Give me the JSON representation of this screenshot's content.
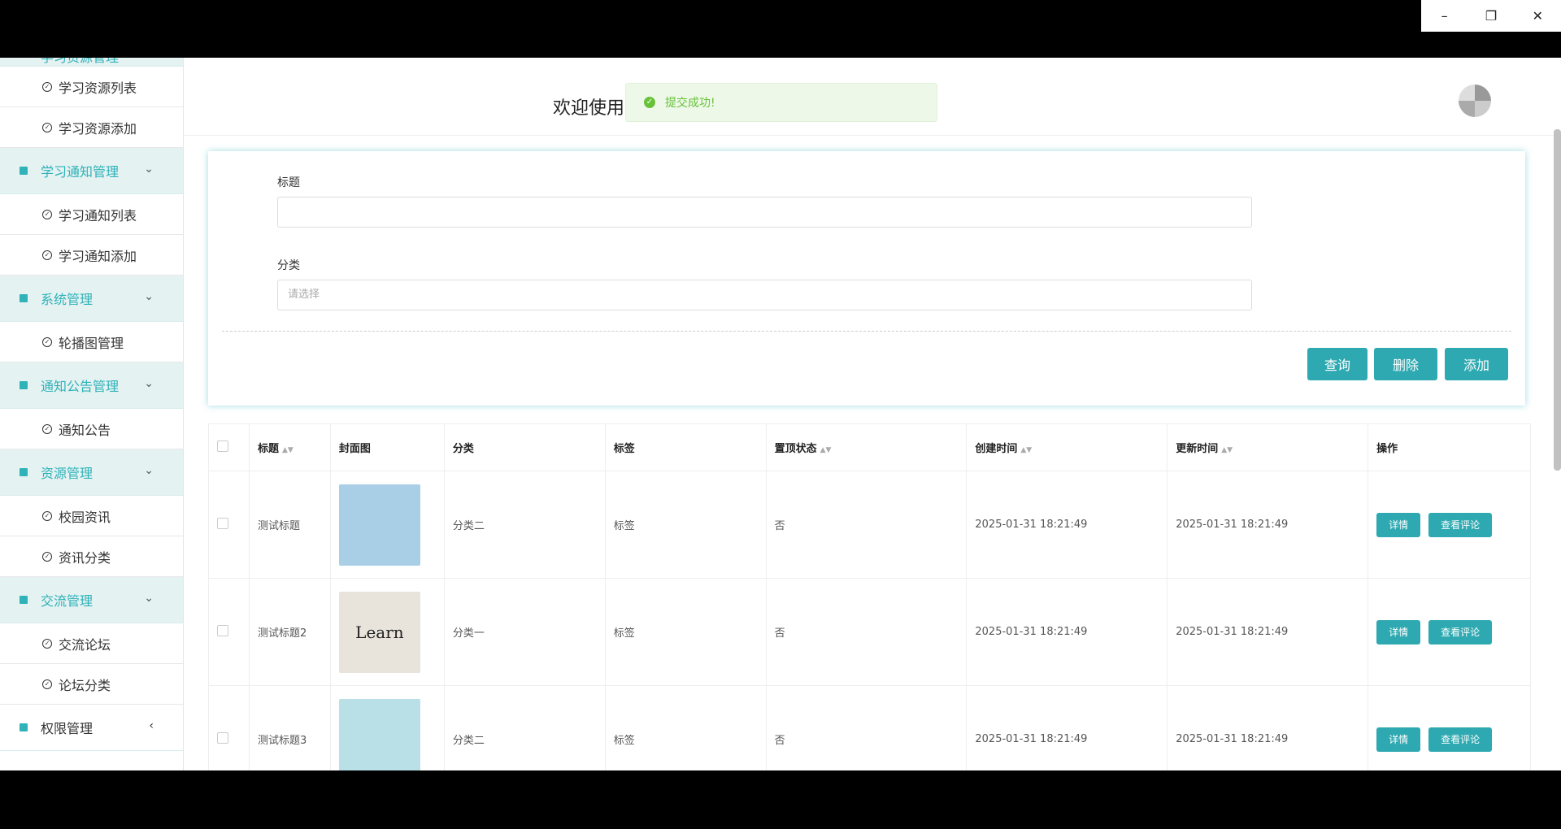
{
  "sidebar": {
    "partial_group": {
      "label": "学习资源管理"
    },
    "groups": [
      {
        "label": "学习资源列表",
        "type": "item"
      },
      {
        "label": "学习资源添加",
        "type": "item"
      }
    ],
    "notice_group": {
      "label": "学习通知管理",
      "items": [
        "学习通知列表",
        "学习通知添加"
      ]
    },
    "system_group": {
      "label": "系统管理",
      "items": [
        "轮播图管理"
      ]
    },
    "announce_group": {
      "label": "通知公告管理",
      "items": [
        "通知公告"
      ]
    },
    "resource_group": {
      "label": "资源管理",
      "items": [
        "校园资讯",
        "资讯分类"
      ]
    },
    "forum_group": {
      "label": "交流管理",
      "items": [
        "交流论坛",
        "论坛分类"
      ]
    },
    "perm_group": {
      "label": "权限管理"
    }
  },
  "header": {
    "welcome": "欢迎使用",
    "toast": "提交成功!"
  },
  "filter": {
    "title_label": "标题",
    "title_value": "",
    "category_label": "分类",
    "category_placeholder": "请选择",
    "query_btn": "查询",
    "delete_btn": "删除",
    "add_btn": "添加"
  },
  "table": {
    "headers": [
      "标题",
      "封面图",
      "分类",
      "标签",
      "置顶状态",
      "创建时间",
      "更新时间",
      "操作"
    ],
    "rows": [
      {
        "title": "测试标题",
        "category": "分类二",
        "tag": "标签",
        "top": "否",
        "created": "2025-01-31 18:21:49",
        "updated": "2025-01-31 18:21:49"
      },
      {
        "title": "测试标题2",
        "category": "分类一",
        "tag": "标签",
        "top": "否",
        "created": "2025-01-31 18:21:49",
        "updated": "2025-01-31 18:21:49"
      },
      {
        "title": "测试标题3",
        "category": "分类二",
        "tag": "标签",
        "top": "否",
        "created": "2025-01-31 18:21:49",
        "updated": "2025-01-31 18:21:49"
      }
    ],
    "detail_btn": "详情",
    "comment_btn": "查看评论",
    "thumb2_text": "Learn"
  },
  "colors": {
    "accent": "#2ea9b1",
    "menu_bg": "#e5f2f2",
    "success": "#67c23a"
  }
}
